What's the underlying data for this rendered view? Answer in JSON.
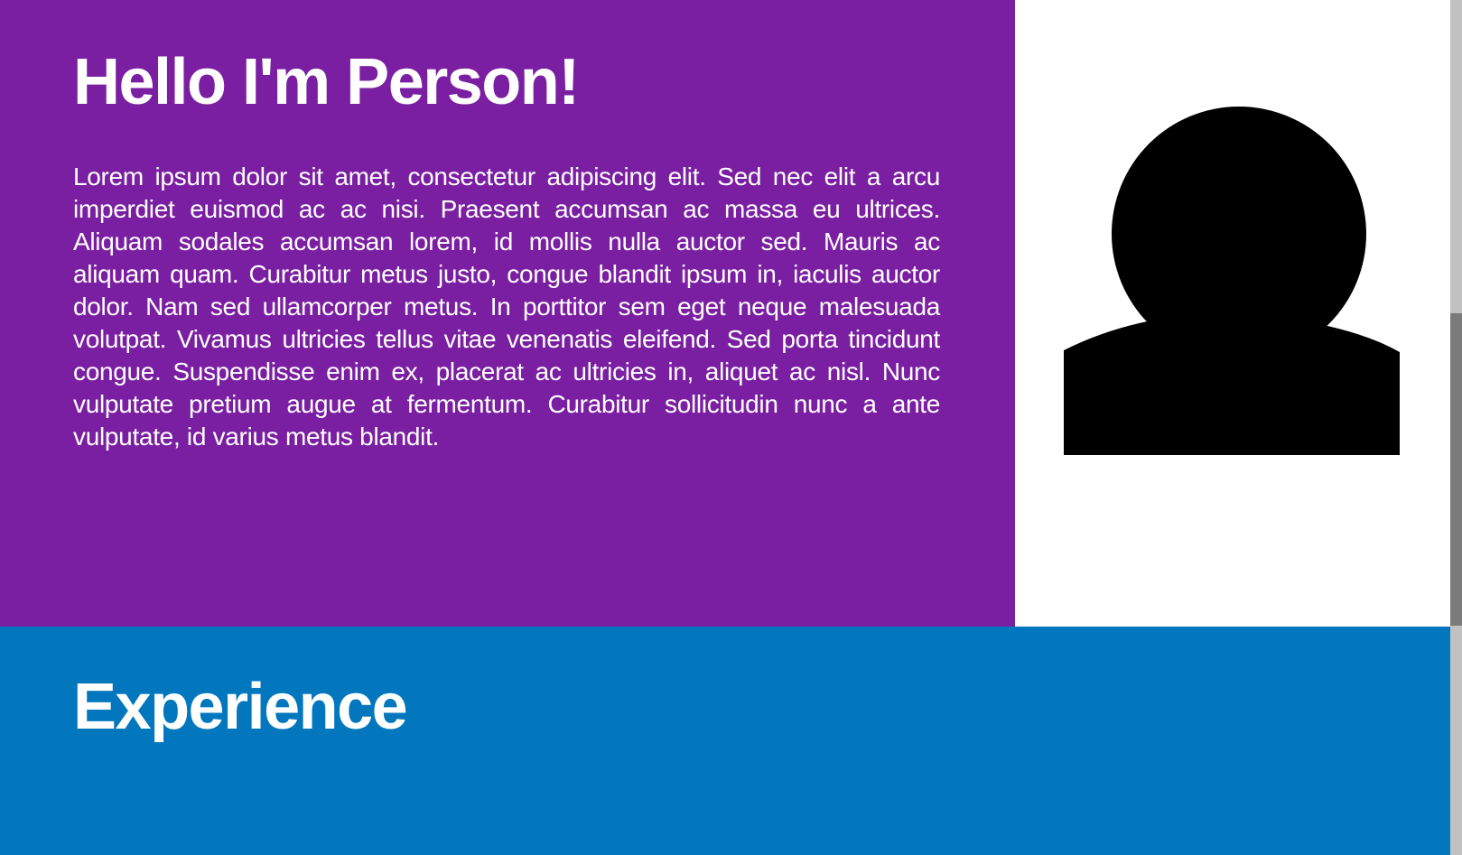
{
  "hero": {
    "title": "Hello I'm Person!",
    "bio": "Lorem ipsum dolor sit amet, consectetur adipiscing elit. Sed nec elit a arcu imperdiet euismod ac ac nisi. Praesent accumsan ac massa eu ultrices. Aliquam sodales accumsan lorem, id mollis nulla auctor sed. Mauris ac aliquam quam. Curabitur metus justo, congue blandit ipsum in, iaculis auctor dolor. Nam sed ullamcorper metus. In porttitor sem eget neque malesuada volutpat. Vivamus ultricies tellus vitae venenatis eleifend. Sed porta tincidunt congue. Suspendisse enim ex, placerat ac ultricies in, aliquet ac nisl. Nunc vulputate pretium augue at fermentum. Curabitur sollicitudin nunc a ante vulputate, id varius metus blandit.",
    "background_color": "#7b1fa2",
    "avatar_icon": "person-silhouette-icon"
  },
  "experience": {
    "title": "Experience",
    "background_color": "#0277bd"
  }
}
